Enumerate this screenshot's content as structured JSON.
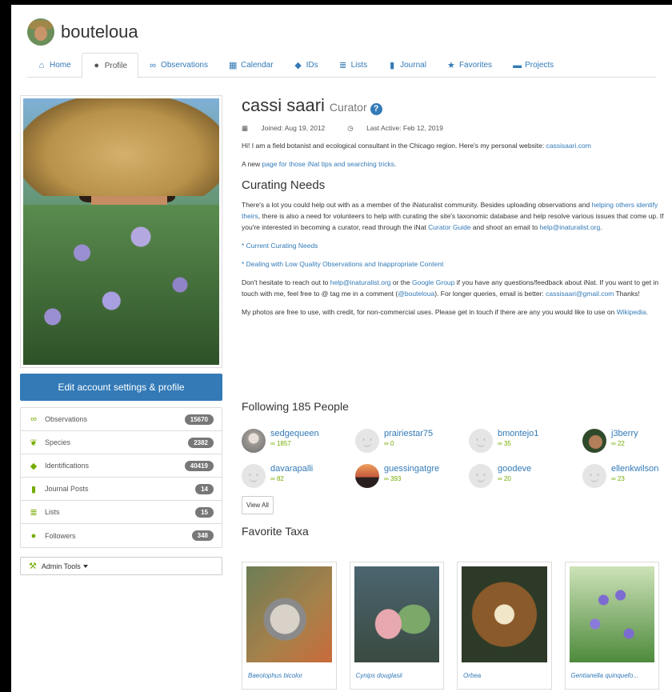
{
  "header": {
    "username": "bouteloua"
  },
  "tabs": [
    {
      "label": "Home",
      "icon": "home-icon"
    },
    {
      "label": "Profile",
      "icon": "user-icon",
      "active": true
    },
    {
      "label": "Observations",
      "icon": "binoculars-icon"
    },
    {
      "label": "Calendar",
      "icon": "calendar-icon"
    },
    {
      "label": "IDs",
      "icon": "tag-icon"
    },
    {
      "label": "Lists",
      "icon": "list-icon"
    },
    {
      "label": "Journal",
      "icon": "book-icon"
    },
    {
      "label": "Favorites",
      "icon": "star-icon"
    },
    {
      "label": "Projects",
      "icon": "briefcase-icon"
    }
  ],
  "sidebar": {
    "edit_button": "Edit account settings & profile",
    "stats": [
      {
        "label": "Observations",
        "count": "15670"
      },
      {
        "label": "Species",
        "count": "2382"
      },
      {
        "label": "Identifications",
        "count": "40419"
      },
      {
        "label": "Journal Posts",
        "count": "14"
      },
      {
        "label": "Lists",
        "count": "15"
      },
      {
        "label": "Followers",
        "count": "348"
      }
    ],
    "admin_tools": "Admin Tools"
  },
  "profile": {
    "name": "cassi saari",
    "role": "Curator",
    "joined": "Joined: Aug 19, 2012",
    "last_active": "Last Active: Feb 12, 2019",
    "bio_p1_text": "Hi! I am a field botanist and ecological consultant in the Chicago region. Here's my personal website: ",
    "bio_p1_link": "cassisaari.com",
    "bio_p2_pre": "A new ",
    "bio_p2_link": "page for those iNat tips and searching tricks",
    "bio_p2_post": ".",
    "curating_heading": "Curating Needs",
    "curating_p1_a": "There's a lot you could help out with as a member of the iNaturalist community. Besides uploading observations and ",
    "curating_p1_link1": "helping others identify theirs",
    "curating_p1_b": ", there is also a need for volunteers to help with curating the site's taxonomic database and help resolve various issues that come up. If you're interested in becoming a curator, read through the iNat ",
    "curating_p1_link2": "Curator Guide",
    "curating_p1_c": " and shoot an email to ",
    "curating_p1_link3": "help@inaturalist.org",
    "curating_p1_d": ".",
    "link_current_curating": "* Current Curating Needs",
    "link_low_quality": "* Dealing with Low Quality Observations and Inappropriate Content",
    "contact_a": "Don't hesitate to reach out to ",
    "contact_link1": "help@inaturalist.org",
    "contact_b": " or the ",
    "contact_link2": "Google Group",
    "contact_c": " if you have any questions/feedback about iNat. If you want to get in touch with me, feel free to @ tag me in a comment (",
    "contact_link3": "@bouteloua",
    "contact_d": "). For longer queries, email is better: ",
    "contact_link4": "cassisaari@gmail.com",
    "contact_e": " Thanks!",
    "photos_a": "My photos are free to use, with credit, for non-commercial uses. Please get in touch if there are any you would like to use on ",
    "photos_link": "Wikipedia",
    "photos_b": "."
  },
  "following": {
    "title": "Following 185 People",
    "people": [
      {
        "name": "sedgequeen",
        "count": "1857"
      },
      {
        "name": "prairiestar75",
        "count": "0"
      },
      {
        "name": "bmontejo1",
        "count": "35"
      },
      {
        "name": "j3berry",
        "count": "22"
      },
      {
        "name": "davarapalli",
        "count": "82"
      },
      {
        "name": "guessingatgre",
        "count": "393"
      },
      {
        "name": "goodeve",
        "count": "20"
      },
      {
        "name": "ellenkwilson",
        "count": "23"
      }
    ],
    "view_all": "View All"
  },
  "favorites": {
    "title": "Favorite Taxa",
    "taxa": [
      "Baeolophus bicolor",
      "Cynips douglasii",
      "Orbea",
      "Gentianella quinquefo..."
    ]
  },
  "colors": {
    "link": "#337ab7",
    "brand_green": "#74ac00",
    "button_blue": "#337ab7"
  }
}
